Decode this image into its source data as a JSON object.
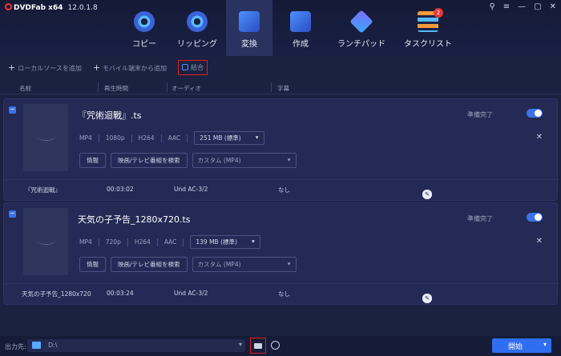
{
  "app": {
    "brand": "DVDFab x64",
    "version": "12.0.1.8"
  },
  "nav": [
    {
      "label": "コピー",
      "icon": "disc-icon"
    },
    {
      "label": "リッピング",
      "icon": "disc-icon"
    },
    {
      "label": "変換",
      "icon": "film-icon"
    },
    {
      "label": "作成",
      "icon": "film-icon"
    },
    {
      "label": "ランチパッド",
      "icon": "rocket-icon"
    },
    {
      "label": "タスクリスト",
      "icon": "list-icon",
      "badge": "2"
    }
  ],
  "toolbar": {
    "add_local": "ローカルソースを追加",
    "add_mobile": "モバイル端末から追加",
    "merge": "結合"
  },
  "columns": {
    "name": "名前",
    "duration": "再生時間",
    "audio": "オーディオ",
    "subtitle": "字幕"
  },
  "items": [
    {
      "title": "『咒術迴戰』.ts",
      "status": "準備完了",
      "format": "MP4",
      "resolution": "1080p",
      "video_codec": "H264",
      "audio_codec": "AAC",
      "size": "251 MB (標準)",
      "info_btn": "情報",
      "search_btn": "映画/テレビ番組を検索",
      "profile": "カスタム (MP4)",
      "track": {
        "name": "『咒術迴戰』",
        "duration": "00:03:02",
        "audio": "Und AC-3/2",
        "subtitle": "なし"
      }
    },
    {
      "title": "天気の子予告_1280x720.ts",
      "status": "準備完了",
      "format": "MP4",
      "resolution": "720p",
      "video_codec": "H264",
      "audio_codec": "AAC",
      "size": "139 MB (標準)",
      "info_btn": "情報",
      "search_btn": "映画/テレビ番組を検索",
      "profile": "カスタム (MP4)",
      "track": {
        "name": "天気の子予告_1280x720",
        "duration": "00:03:24",
        "audio": "Und AC-3/2",
        "subtitle": "なし"
      }
    }
  ],
  "output": {
    "label": "出力先:",
    "path": "D:\\"
  },
  "start_label": "開始"
}
